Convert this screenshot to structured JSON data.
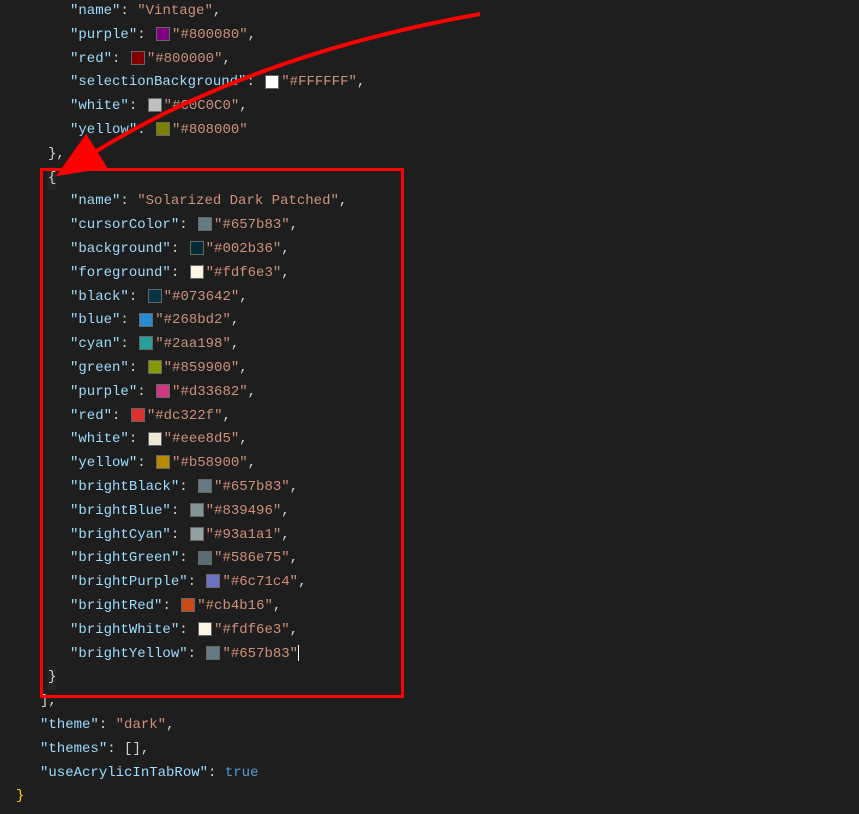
{
  "vintage": {
    "name": "Vintage",
    "purple": "#800080",
    "red": "#800000",
    "selectionBackground": "#FFFFFF",
    "white": "#C0C0C0",
    "yellow": "#808000"
  },
  "solarized": {
    "name": "Solarized Dark Patched",
    "cursorColor": "#657b83",
    "background": "#002b36",
    "foreground": "#fdf6e3",
    "black": "#073642",
    "blue": "#268bd2",
    "cyan": "#2aa198",
    "green": "#859900",
    "purple": "#d33682",
    "red": "#dc322f",
    "white": "#eee8d5",
    "yellow": "#b58900",
    "brightBlack": "#657b83",
    "brightBlue": "#839496",
    "brightCyan": "#93a1a1",
    "brightGreen": "#586e75",
    "brightPurple": "#6c71c4",
    "brightRed": "#cb4b16",
    "brightWhite": "#fdf6e3",
    "brightYellow": "#657b83"
  },
  "footer": {
    "themeKey": "theme",
    "themeValue": "dark",
    "themesKey": "themes",
    "acrylicKey": "useAcrylicInTabRow",
    "acrylicValue": "true"
  },
  "labels": {
    "name": "name",
    "purple": "purple",
    "red": "red",
    "selectionBackground": "selectionBackground",
    "white": "white",
    "yellow": "yellow",
    "cursorColor": "cursorColor",
    "background": "background",
    "foreground": "foreground",
    "black": "black",
    "blue": "blue",
    "cyan": "cyan",
    "green": "green",
    "brightBlack": "brightBlack",
    "brightBlue": "brightBlue",
    "brightCyan": "brightCyan",
    "brightGreen": "brightGreen",
    "brightPurple": "brightPurple",
    "brightRed": "brightRed",
    "brightWhite": "brightWhite",
    "brightYellow": "brightYellow"
  }
}
